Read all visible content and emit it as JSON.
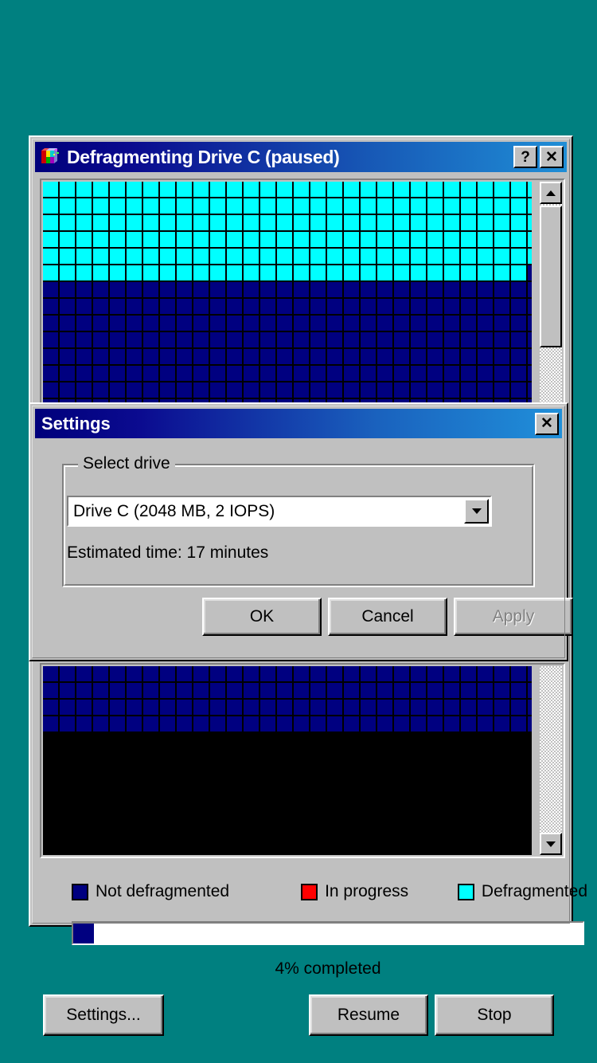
{
  "desktop": {
    "background_color": "#008080"
  },
  "main_window": {
    "title": "Defragmenting Drive C (paused)",
    "icon": "defrag-icon",
    "help_button_label": "?",
    "close_button_label": "✕"
  },
  "block_map": {
    "columns": 31,
    "block_colors": {
      "defragmented": "#00ffff",
      "not_defragmented": "#000080",
      "in_progress": "#ff0000",
      "gap": "#000000"
    },
    "top_panel_rows": [
      {
        "defragmented_count": 31,
        "total": 31
      },
      {
        "defragmented_count": 31,
        "total": 31
      },
      {
        "defragmented_count": 31,
        "total": 31
      },
      {
        "defragmented_count": 31,
        "total": 31
      },
      {
        "defragmented_count": 31,
        "total": 31
      },
      {
        "defragmented_count": 29,
        "total": 31
      },
      {
        "defragmented_count": 0,
        "total": 31
      },
      {
        "defragmented_count": 0,
        "total": 31
      },
      {
        "defragmented_count": 0,
        "total": 31
      },
      {
        "defragmented_count": 0,
        "total": 31
      },
      {
        "defragmented_count": 0,
        "total": 31
      },
      {
        "defragmented_count": 0,
        "total": 31
      },
      {
        "defragmented_count": 0,
        "total": 31
      },
      {
        "defragmented_count": 0,
        "total": 31
      }
    ],
    "bottom_panel_rows": [
      {
        "defragmented_count": 0,
        "total": 31
      },
      {
        "defragmented_count": 0,
        "total": 31
      },
      {
        "defragmented_count": 0,
        "total": 31
      },
      {
        "defragmented_count": 0,
        "total": 31
      }
    ]
  },
  "scrollbar": {
    "up_arrow": "scroll-up-arrow",
    "down_arrow": "scroll-down-arrow",
    "thumb": "scroll-thumb"
  },
  "legend": [
    {
      "label": "Not defragmented",
      "color": "#000080"
    },
    {
      "label": "In progress",
      "color": "#ff0000"
    },
    {
      "label": "Defragmented",
      "color": "#00ffff"
    }
  ],
  "progress": {
    "percent": 4,
    "label": "4% completed",
    "fill_color": "#000080"
  },
  "footer_buttons": {
    "settings": "Settings...",
    "resume": "Resume",
    "stop": "Stop"
  },
  "settings_dialog": {
    "title": "Settings",
    "close_button_label": "✕",
    "group_title": "Select drive",
    "drive_select": {
      "value": "Drive C (2048 MB, 2 IOPS)",
      "options": [
        "Drive C (2048 MB, 2 IOPS)"
      ]
    },
    "estimated_time": "Estimated time: 17 minutes",
    "buttons": {
      "ok": "OK",
      "cancel": "Cancel",
      "apply": "Apply",
      "apply_disabled": true
    }
  }
}
